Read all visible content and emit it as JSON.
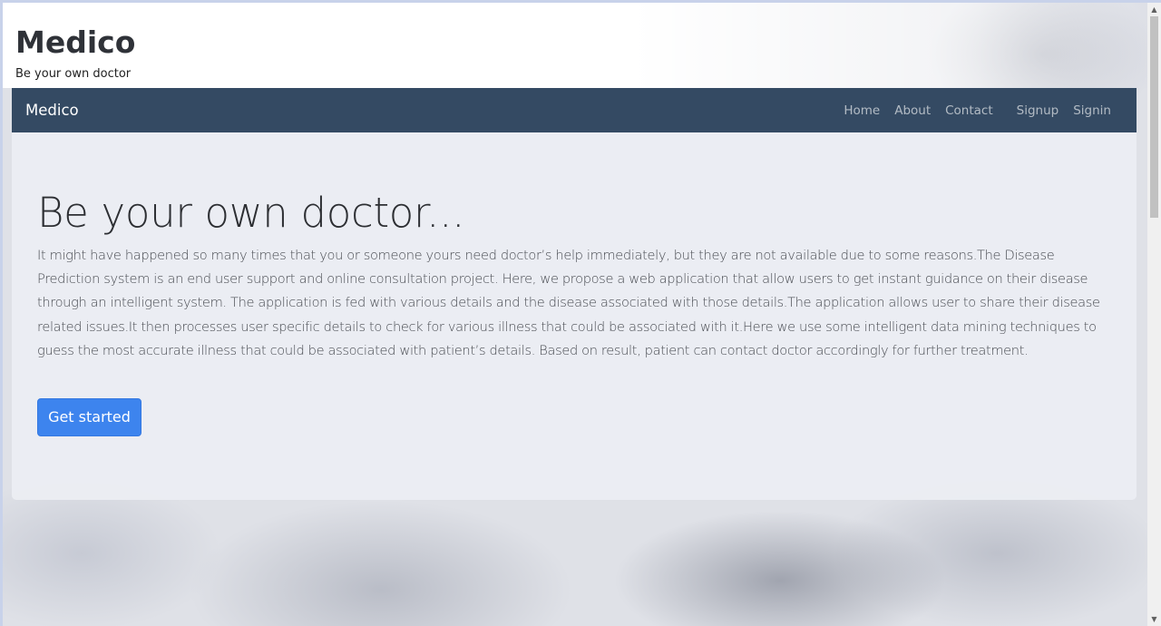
{
  "header": {
    "title": "Medico",
    "tagline": "Be your own doctor"
  },
  "navbar": {
    "brand": "Medico",
    "links": [
      {
        "label": "Home"
      },
      {
        "label": "About"
      },
      {
        "label": "Contact"
      },
      {
        "label": "Signup"
      },
      {
        "label": "Signin"
      }
    ]
  },
  "hero": {
    "title": "Be your own doctor...",
    "body": "It might have happened so many times that you or someone yours need doctor’s help immediately, but they are not available due to some reasons.The Disease Prediction system is an end user support and online consultation project. Here, we propose a web application that allow users to get instant guidance on their disease through an intelligent system. The application is fed with various details and the disease associated with those details.The application allows user to share their disease related issues.It then processes user specific details to check for various illness that could be associated with it.Here we use some intelligent data mining techniques to guess the most accurate illness that could be associated with patient’s details. Based on result, patient can contact doctor accordingly for further treatment.",
    "cta_label": "Get started"
  },
  "colors": {
    "navbar_bg": "#344a63",
    "button_bg": "#3d84ee"
  }
}
